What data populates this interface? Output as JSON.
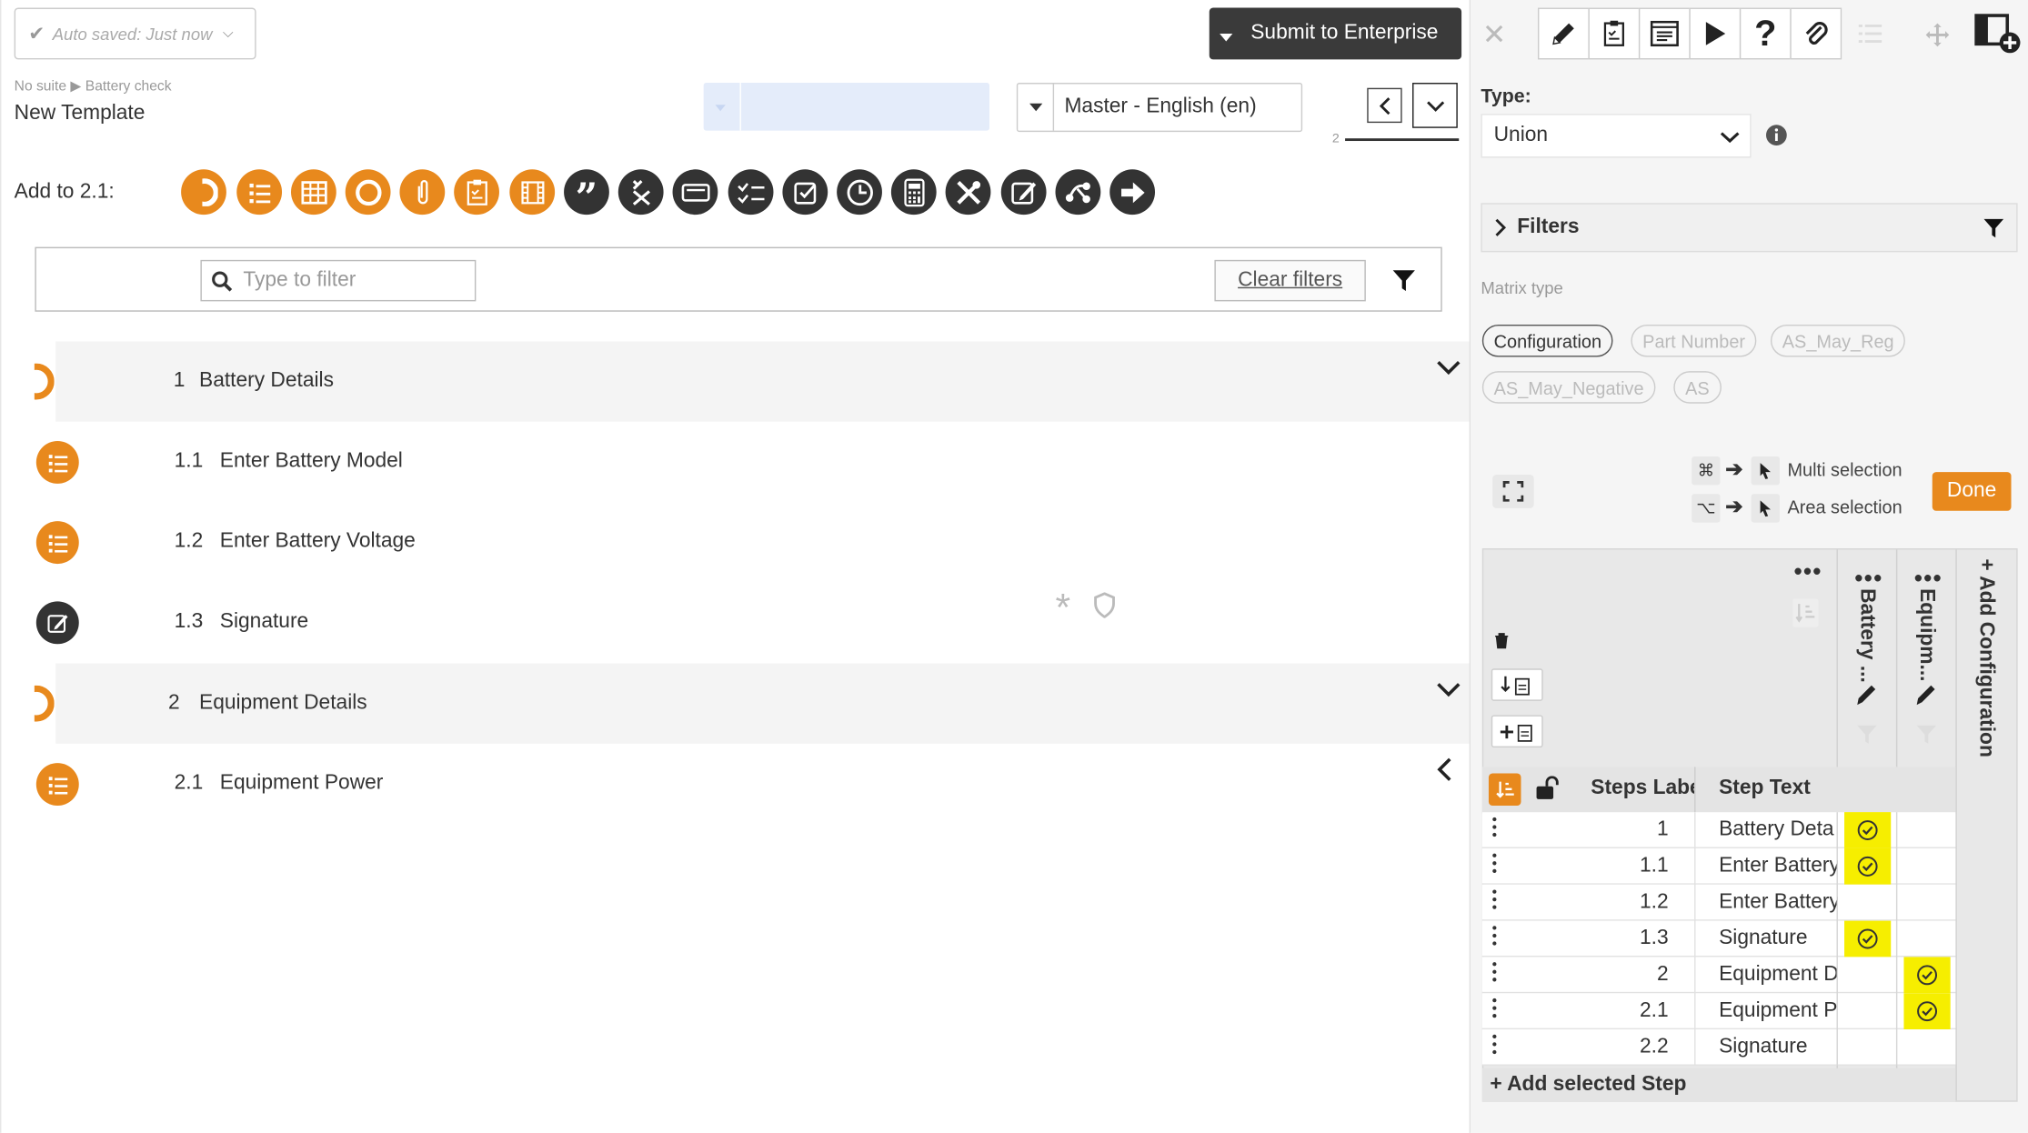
{
  "header": {
    "autosave": "Auto saved: Just now",
    "submit_label": "Submit to Enterprise",
    "breadcrumb_suite": "No suite",
    "breadcrumb_sep": "▶",
    "breadcrumb_item": "Battery check",
    "template_name": "New Template",
    "language": "Master - English (en)",
    "page_number": "2"
  },
  "add_to": {
    "label": "Add to 2.1:",
    "icons": [
      "section-icon",
      "list-icon",
      "table-icon",
      "circle-icon",
      "attachment-icon",
      "checklist-icon",
      "film-icon",
      "quote-icon",
      "cancel-icon",
      "input-box-icon",
      "checked-list-icon",
      "checkbox-icon",
      "clock-icon",
      "calculator-icon",
      "tools-icon",
      "edit-icon",
      "share-icon",
      "arrow-right-icon"
    ]
  },
  "filter": {
    "placeholder": "Type to filter",
    "clear_label": "Clear filters"
  },
  "steps": [
    {
      "num": "1",
      "text": "Battery Details",
      "kind": "section"
    },
    {
      "num": "1.1",
      "text": "Enter Battery Model",
      "kind": "list"
    },
    {
      "num": "1.2",
      "text": "Enter Battery Voltage",
      "kind": "list"
    },
    {
      "num": "1.3",
      "text": "Signature",
      "kind": "signature"
    },
    {
      "num": "2",
      "text": "Equipment Details",
      "kind": "section"
    },
    {
      "num": "2.1",
      "text": "Equipment Power",
      "kind": "list"
    }
  ],
  "panel": {
    "type_label": "Type:",
    "type_value": "Union",
    "filters_label": "Filters",
    "matrix_type_label": "Matrix type",
    "matrix_types": [
      {
        "label": "Configuration",
        "active": true
      },
      {
        "label": "Part Number",
        "active": false
      },
      {
        "label": "AS_May_Reg",
        "active": false
      },
      {
        "label": "AS_May_Negative",
        "active": false
      },
      {
        "label": "AS",
        "active": false
      }
    ],
    "multi_key": "⌘",
    "multi_label": "Multi selection",
    "area_key": "⌥",
    "area_label": "Area selection",
    "done_label": "Done"
  },
  "matrix": {
    "col_label": "Steps Labe",
    "col_text": "Step Text",
    "config_cols": [
      "Battery ...",
      "Equipm..."
    ],
    "add_config": "+ Add Configuration",
    "add_step": "+ Add selected Step",
    "rows": [
      {
        "label": "1",
        "text": "Battery Deta",
        "c1": true,
        "c2": false
      },
      {
        "label": "1.1",
        "text": "Enter Battery",
        "c1": true,
        "c2": false
      },
      {
        "label": "1.2",
        "text": "Enter Battery",
        "c1": false,
        "c2": false
      },
      {
        "label": "1.3",
        "text": "Signature",
        "c1": true,
        "c2": false
      },
      {
        "label": "2",
        "text": "Equipment D",
        "c1": false,
        "c2": true
      },
      {
        "label": "2.1",
        "text": "Equipment P",
        "c1": false,
        "c2": true
      },
      {
        "label": "2.2",
        "text": "Signature",
        "c1": false,
        "c2": false
      }
    ]
  },
  "colors": {
    "accent": "#e8891d",
    "dark": "#333333",
    "highlight": "#f6ee00"
  }
}
